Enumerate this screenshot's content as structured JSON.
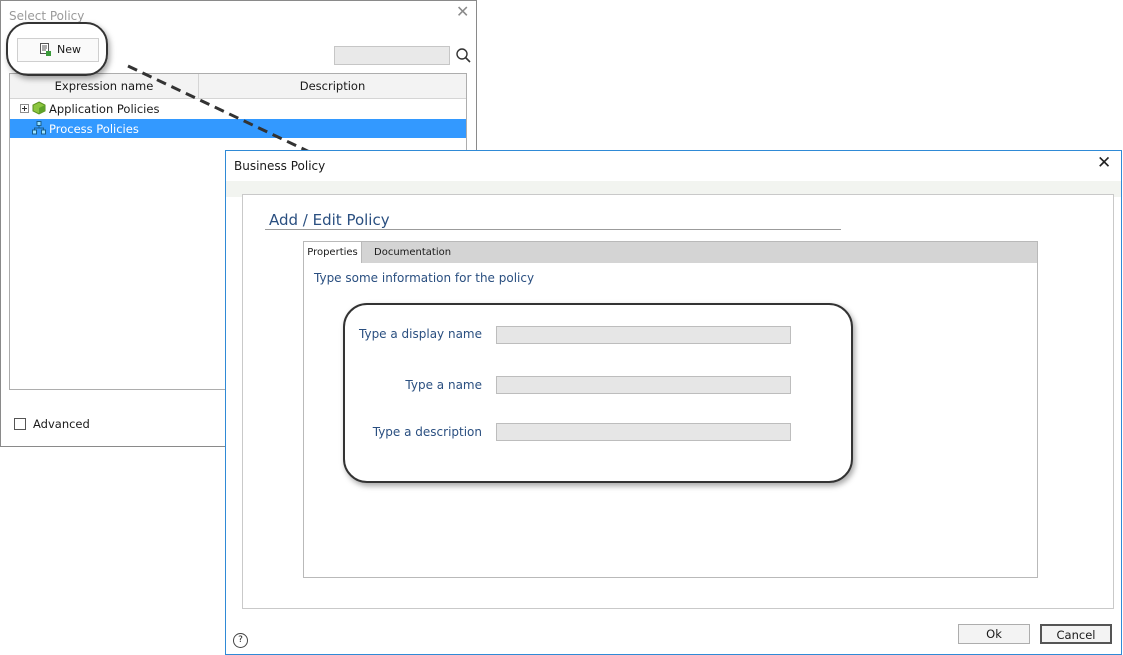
{
  "select_policy": {
    "title": "Select Policy",
    "new_label": "New",
    "columns": [
      "Expression name",
      "Description"
    ],
    "rows": [
      {
        "label": "Application Policies"
      },
      {
        "label": "Process Policies",
        "selected": true
      }
    ],
    "advanced_label": "Advanced"
  },
  "business_policy": {
    "title": "Business Policy",
    "heading": "Add / Edit Policy",
    "tabs": [
      "Properties",
      "Documentation"
    ],
    "hint": "Type some information for the policy",
    "fields": [
      {
        "label": "Type a display name",
        "value": ""
      },
      {
        "label": "Type a name",
        "value": ""
      },
      {
        "label": "Type a description",
        "value": ""
      }
    ],
    "ok_label": "Ok",
    "cancel_label": "Cancel",
    "help_glyph": "?"
  },
  "icons": {
    "close": "close-icon",
    "search": "search-icon",
    "new": "new-document-icon",
    "app_policy": "green-cube-icon",
    "process_policy": "process-flow-icon",
    "help": "help-icon"
  },
  "colors": {
    "selection": "#3399ff",
    "accent_border": "#2f8ad6",
    "heading": "#2a4f80"
  }
}
